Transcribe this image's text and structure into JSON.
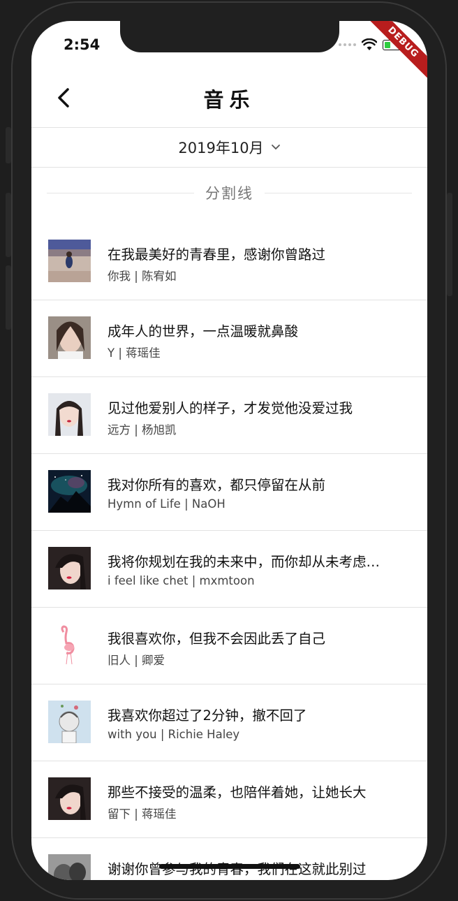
{
  "status_bar": {
    "time": "2:54",
    "debug_label": "DEBUG"
  },
  "nav": {
    "title": "音乐"
  },
  "filter": {
    "month": "2019年10月"
  },
  "divider": {
    "label": "分割线"
  },
  "songs": [
    {
      "title": "在我最美好的青春里，感谢你曾路过",
      "subtitle": "你我 | 陈宥如",
      "cover": "beach-photo"
    },
    {
      "title": "成年人的世界，一点温暖就鼻酸",
      "subtitle": "Y | 蒋瑶佳",
      "cover": "girl-portrait"
    },
    {
      "title": "见过他爱别人的样子，才发觉他没爱过我",
      "subtitle": "远方 | 杨旭凯",
      "cover": "girl-portrait"
    },
    {
      "title": "我对你所有的喜欢，都只停留在从前",
      "subtitle": "Hymn of Life | NaOH",
      "cover": "starry-sky"
    },
    {
      "title": "我将你规划在我的未来中，而你却从未考虑…",
      "subtitle": "i feel like chet | mxmtoon",
      "cover": "girl-portrait"
    },
    {
      "title": "我很喜欢你，但我不会因此丢了自己",
      "subtitle": "旧人 | 卿爱",
      "cover": "flamingo-drawing"
    },
    {
      "title": "我喜欢你超过了2分钟，撤不回了",
      "subtitle": "with you | Richie Haley",
      "cover": "anime-illustration"
    },
    {
      "title": "那些不接受的温柔，也陪伴着她，让她长大",
      "subtitle": "留下 | 蒋瑶佳",
      "cover": "girl-portrait"
    },
    {
      "title": "谢谢你曾参与我的青春，我们在这就此别过",
      "subtitle": "",
      "cover": "bw-photo"
    }
  ],
  "icons": {
    "back": "chevron-left-icon",
    "dropdown": "chevron-down-icon",
    "wifi": "wifi-icon",
    "battery": "battery-icon"
  },
  "colors": {
    "accent": "#111111",
    "divider": "#e2e2e2",
    "debug": "#b81d1d"
  }
}
